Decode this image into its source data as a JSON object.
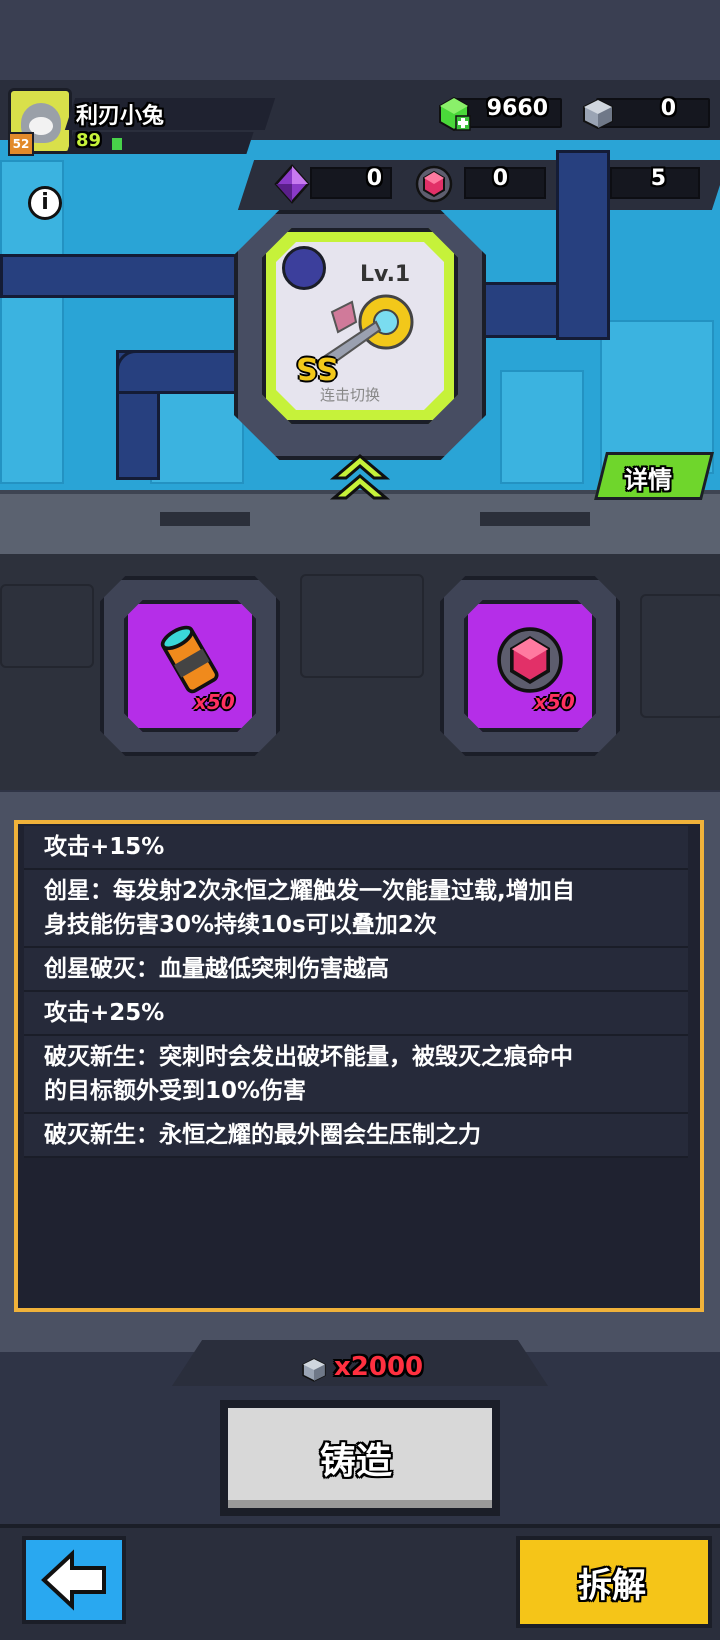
{
  "player": {
    "name": "利刃小兔",
    "level": "89",
    "badge": "52"
  },
  "resources": {
    "gems": "9660",
    "ore": "0"
  },
  "materials": {
    "crystal": "0",
    "core": "0",
    "canister": "5"
  },
  "machine": {
    "level": "Lv.1",
    "grade": "SS",
    "caption": "连击切换"
  },
  "buttons": {
    "detail": "详情",
    "forge": "铸造",
    "dismantle": "拆解",
    "info": "i"
  },
  "slots": [
    {
      "item": "canister-icon",
      "count": "x50"
    },
    {
      "item": "core-icon",
      "count": "x50"
    }
  ],
  "description": [
    {
      "text": "攻击+15%"
    },
    {
      "text": "创星：每发射2次永恒之耀触发一次能量过载,增加自",
      "text2": "身技能伤害30%持续10s可以叠加2次"
    },
    {
      "text": "创星破灭：血量越低突刺伤害越高"
    },
    {
      "text": "攻击+25%"
    },
    {
      "text": "破灭新生：突刺时会发出破坏能量，被毁灭之痕命中",
      "text2": "的目标额外受到10%伤害"
    },
    {
      "text": "破灭新生：永恒之耀的最外圈会生压制之力"
    }
  ],
  "cost": {
    "label": "x2000",
    "icon": "ore-icon"
  },
  "colors": {
    "accent_yellow": "#f5c518",
    "lime": "#c6f23a",
    "slot_purple": "#b52ee8",
    "panel_border": "#f0b23a"
  }
}
